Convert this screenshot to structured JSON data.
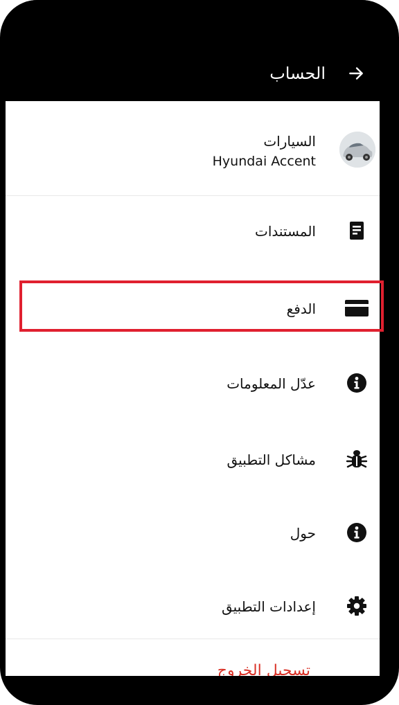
{
  "header": {
    "title": "الحساب",
    "back_icon": "arrow-right-icon"
  },
  "account": {
    "car": {
      "label": "السيارات",
      "model": "Hyundai Accent",
      "icon": "car-avatar"
    },
    "items": [
      {
        "label": "المستندات",
        "icon": "document-icon"
      },
      {
        "label": "الدفع",
        "icon": "credit-card-icon",
        "highlighted": true
      },
      {
        "label": "عدّل المعلومات",
        "icon": "info-icon"
      },
      {
        "label": "مشاكل التطبيق",
        "icon": "bug-icon"
      },
      {
        "label": "حول",
        "icon": "info-icon"
      },
      {
        "label": "إعدادات التطبيق",
        "icon": "gear-icon"
      }
    ],
    "logout_label": "تسجيل الخروج"
  },
  "colors": {
    "highlight": "#e0202f",
    "logout": "#d93025",
    "header_bg": "#000000"
  }
}
